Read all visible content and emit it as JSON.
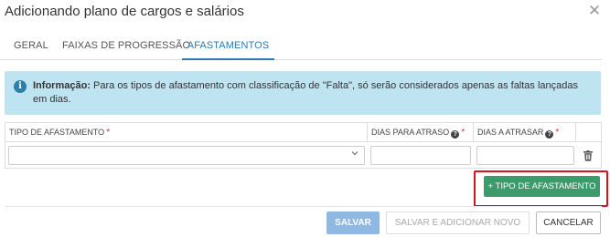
{
  "dialog": {
    "title": "Adicionando plano de cargos e salários"
  },
  "tabs": [
    {
      "label": "GERAL"
    },
    {
      "label": "FAIXAS DE PROGRESSÃO"
    },
    {
      "label": "AFASTAMENTOS"
    }
  ],
  "active_tab": "AFASTAMENTOS",
  "info": {
    "label": "Informação:",
    "text": " Para os tipos de afastamento com classificação de \"Falta\", só serão considerados apenas as faltas lançadas em dias."
  },
  "table": {
    "columns": [
      {
        "label": "TIPO DE AFASTAMENTO",
        "required": "*"
      },
      {
        "label": "DIAS PARA ATRASO",
        "required": "*"
      },
      {
        "label": "DIAS A ATRASAR",
        "required": "*"
      }
    ],
    "row": {
      "tipo_value": "",
      "dias_para_atraso": "",
      "dias_a_atrasar": ""
    }
  },
  "buttons": {
    "add_tipo": "+ TIPO DE AFASTAMENTO",
    "save": "SALVAR",
    "save_new": "SALVAR E ADICIONAR NOVO",
    "cancel": "CANCELAR"
  },
  "colors": {
    "accent_tab": "#2a7ab8",
    "info_bg": "#bfe4f1",
    "add_button": "#3d9a6a",
    "highlight": "#d9141b",
    "save_button": "#8fb9e3"
  }
}
